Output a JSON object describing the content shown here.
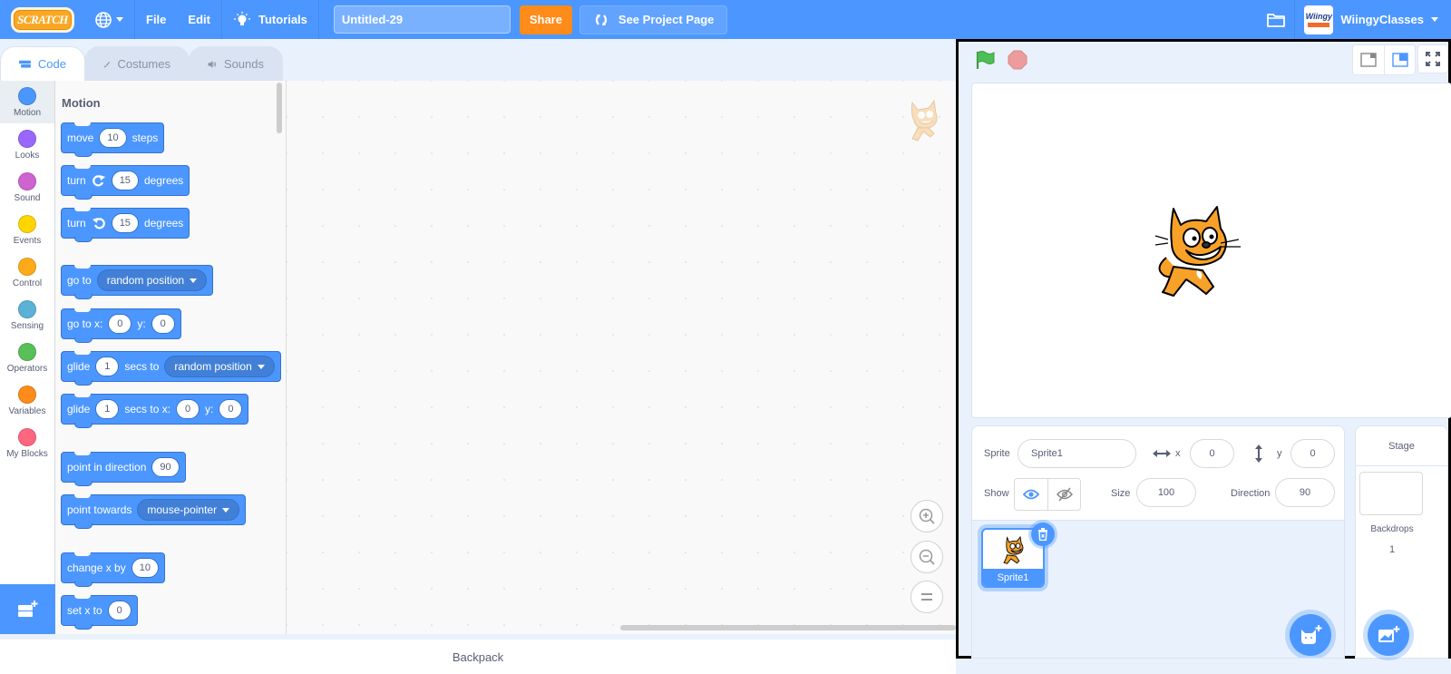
{
  "menubar": {
    "logo": "SCRATCH",
    "file_label": "File",
    "edit_label": "Edit",
    "tutorials_label": "Tutorials",
    "project_title": "Untitled-29",
    "share_label": "Share",
    "see_project_label": "See Project Page",
    "avatar_text": "Wiingy",
    "username": "WiingyClasses"
  },
  "tabs": [
    {
      "label": "Code",
      "active": true
    },
    {
      "label": "Costumes",
      "active": false
    },
    {
      "label": "Sounds",
      "active": false
    }
  ],
  "categories": [
    {
      "label": "Motion",
      "color": "#4c97ff",
      "selected": true
    },
    {
      "label": "Looks",
      "color": "#9966ff"
    },
    {
      "label": "Sound",
      "color": "#cf63cf"
    },
    {
      "label": "Events",
      "color": "#ffd500"
    },
    {
      "label": "Control",
      "color": "#ffab19"
    },
    {
      "label": "Sensing",
      "color": "#5cb1d6"
    },
    {
      "label": "Operators",
      "color": "#59c059"
    },
    {
      "label": "Variables",
      "color": "#ff8c1a"
    },
    {
      "label": "My Blocks",
      "color": "#ff6680"
    }
  ],
  "palette": {
    "title": "Motion",
    "blocks": {
      "move": {
        "t1": "move",
        "v1": "10",
        "t2": "steps"
      },
      "turn_right": {
        "t1": "turn",
        "v1": "15",
        "t2": "degrees"
      },
      "turn_left": {
        "t1": "turn",
        "v1": "15",
        "t2": "degrees"
      },
      "goto": {
        "t1": "go to",
        "d1": "random position"
      },
      "goto_xy": {
        "t1": "go to x:",
        "v1": "0",
        "t2": "y:",
        "v2": "0"
      },
      "glide_to": {
        "t1": "glide",
        "v1": "1",
        "t2": "secs to",
        "d1": "random position"
      },
      "glide_xy": {
        "t1": "glide",
        "v1": "1",
        "t2": "secs to x:",
        "v2": "0",
        "t3": "y:",
        "v3": "0"
      },
      "point_dir": {
        "t1": "point in direction",
        "v1": "90"
      },
      "point_towards": {
        "t1": "point towards",
        "d1": "mouse-pointer"
      },
      "change_x": {
        "t1": "change x by",
        "v1": "10"
      },
      "set_x": {
        "t1": "set x to",
        "v1": "0"
      }
    }
  },
  "backpack_label": "Backpack",
  "sprite_info": {
    "sprite_label": "Sprite",
    "sprite_name": "Sprite1",
    "x_label": "x",
    "x_value": "0",
    "y_label": "y",
    "y_value": "0",
    "show_label": "Show",
    "size_label": "Size",
    "size_value": "100",
    "direction_label": "Direction",
    "direction_value": "90"
  },
  "sprites": [
    {
      "name": "Sprite1",
      "selected": true
    }
  ],
  "stage_pane": {
    "title": "Stage",
    "backdrops_label": "Backdrops",
    "backdrops_count": "1"
  },
  "colors": {
    "accent": "#4c97ff",
    "share": "#ff8c1a",
    "flag": "#4cbf56",
    "stop": "#ec9c9c"
  }
}
